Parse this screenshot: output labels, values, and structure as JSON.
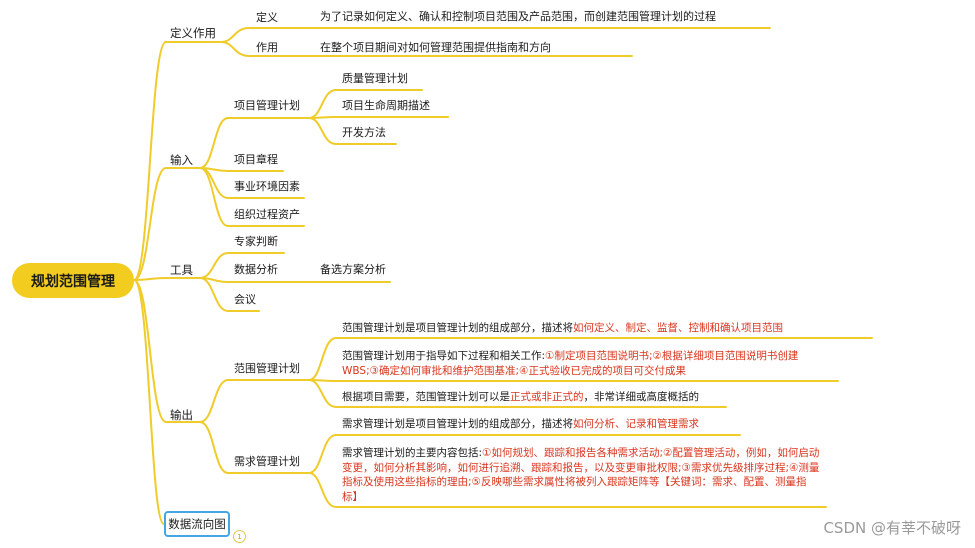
{
  "root": {
    "label": "规划范围管理"
  },
  "branches": {
    "definition_purpose": {
      "label": "定义作用",
      "definition": {
        "label": "定义",
        "text": "为了记录如何定义、确认和控制项目范围及产品范围，而创建范围管理计划的过程"
      },
      "purpose": {
        "label": "作用",
        "text": "在整个项目期间对如何管理范围提供指南和方向"
      }
    },
    "inputs": {
      "label": "输入",
      "pmp": {
        "label": "项目管理计划",
        "items": [
          "质量管理计划",
          "项目生命周期描述",
          "开发方法"
        ]
      },
      "charter": "项目章程",
      "eef": "事业环境因素",
      "opa": "组织过程资产"
    },
    "tools": {
      "label": "工具",
      "expert": "专家判断",
      "data_analysis": {
        "label": "数据分析",
        "item": "备选方案分析"
      },
      "meetings": "会议"
    },
    "outputs": {
      "label": "输出",
      "scope_plan": {
        "label": "范围管理计划",
        "p1_prefix": "范围管理计划是项目管理计划的组成部分，描述将",
        "p1_red": "如何定义、制定、监督、控制和确认项目范围",
        "p2_prefix": "范围管理计划用于指导如下过程和相关工作:",
        "p2_red": "①制定项目范围说明书;②根据详细项目范围说明书创建WBS;③确定如何审批和维护范围基准;④正式验收已完成的项目可交付成果",
        "p3_prefix": "根据项目需要，范围管理计划可以是",
        "p3_red": "正式或非正式的",
        "p3_suffix": "，非常详细或高度概括的"
      },
      "req_plan": {
        "label": "需求管理计划",
        "p1_prefix": "需求管理计划是项目管理计划的组成部分，描述将",
        "p1_red": "如何分析、记录和管理需求",
        "p2_prefix": "需求管理计划的主要内容包括:",
        "p2_red": "①如何规划、跟踪和报告各种需求活动;②配置管理活动，例如，如何启动变更，如何分析其影响，如何进行追溯、跟踪和报告，以及变更审批权限;③需求优先级排序过程;④测量指标及使用这些指标的理由;⑤反映哪些需求属性将被列入跟踪矩阵等【关键词：需求、配置、测量指标】"
      }
    },
    "dataflow": {
      "label": "数据流向图",
      "badge": "1"
    }
  },
  "watermark": "CSDN @有莘不破呀",
  "colors": {
    "root_fill": "#f2cc1e",
    "line": "#f0cc2a",
    "highlight": "#d9351e",
    "dataflow_border": "#43a7e6"
  }
}
